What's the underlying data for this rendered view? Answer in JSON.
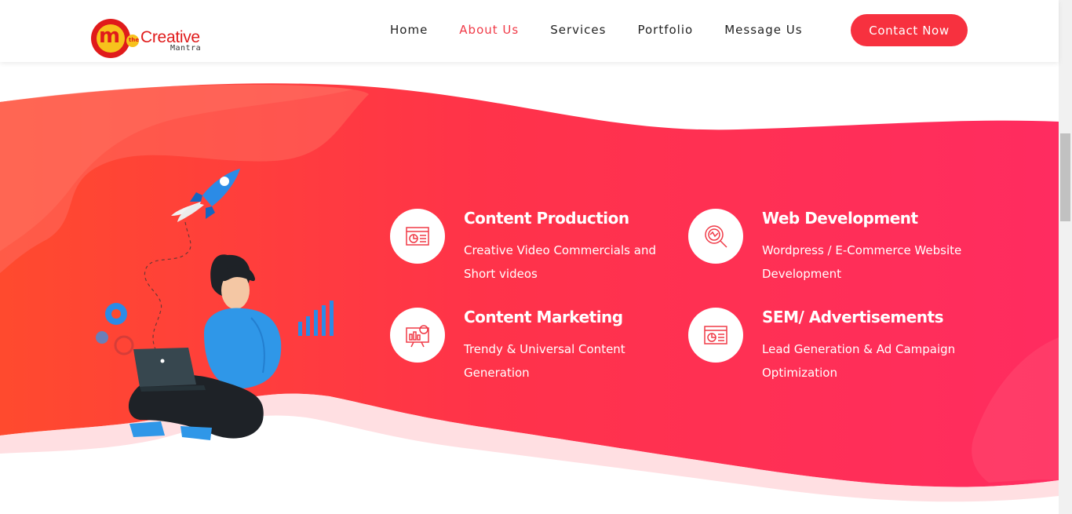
{
  "brand": {
    "logo_letter": "m",
    "logo_small": "the",
    "logo_word": "Creative",
    "logo_sub": "Mantra",
    "red": "#f7313f",
    "yellow": "#f7c21c"
  },
  "nav": {
    "items": [
      {
        "label": "Home",
        "active": false
      },
      {
        "label": "About Us",
        "active": true
      },
      {
        "label": "Services",
        "active": false
      },
      {
        "label": "Portfolio",
        "active": false
      },
      {
        "label": "Message Us",
        "active": false
      }
    ],
    "cta": "Contact Now"
  },
  "services": [
    {
      "title": "Content Production",
      "desc": "Creative Video Commercials and Short videos",
      "icon": "presentation-chart-icon"
    },
    {
      "title": "Web Development",
      "desc": "Wordpress / E-Commerce Website Development",
      "icon": "web-search-icon"
    },
    {
      "title": "Content Marketing",
      "desc": "Trendy & Universal Content Generation",
      "icon": "analytics-board-icon"
    },
    {
      "title": "SEM/ Advertisements",
      "desc": "Lead Generation & Ad Campaign Optimization",
      "icon": "ad-report-icon"
    }
  ],
  "colors": {
    "gradient_start": "#ff4b2b",
    "gradient_end": "#ff2d5f",
    "accent_blue": "#1e88e5"
  }
}
